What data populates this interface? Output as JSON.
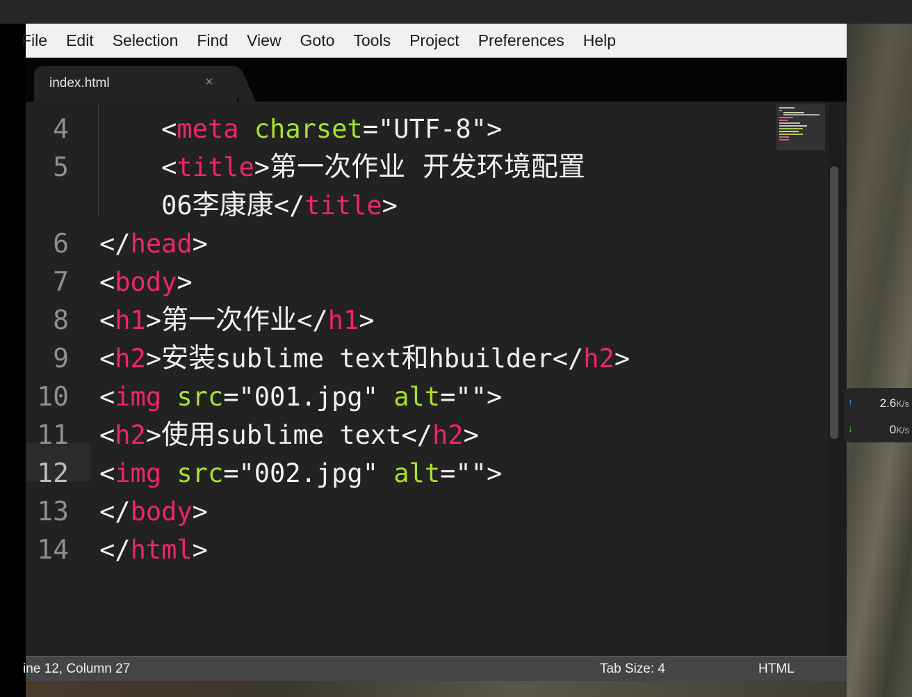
{
  "menubar": {
    "items": [
      "File",
      "Edit",
      "Selection",
      "Find",
      "View",
      "Goto",
      "Tools",
      "Project",
      "Preferences",
      "Help"
    ]
  },
  "tab": {
    "title": "index.html",
    "close_glyph": "×"
  },
  "editor": {
    "current_line": 12,
    "lines": [
      {
        "number": "4",
        "tokens": [
          {
            "t": "    ",
            "c": "p"
          },
          {
            "t": "<",
            "c": "p"
          },
          {
            "t": "meta",
            "c": "tag"
          },
          {
            "t": " ",
            "c": "p"
          },
          {
            "t": "charset",
            "c": "attr"
          },
          {
            "t": "=",
            "c": "p"
          },
          {
            "t": "\"UTF-8\"",
            "c": "p"
          },
          {
            "t": ">",
            "c": "p"
          }
        ]
      },
      {
        "number": "5",
        "tokens": [
          {
            "t": "    ",
            "c": "p"
          },
          {
            "t": "<",
            "c": "p"
          },
          {
            "t": "title",
            "c": "tag"
          },
          {
            "t": ">",
            "c": "p"
          },
          {
            "t": "第一次作业  开发环境配置",
            "c": "cjk"
          }
        ]
      },
      {
        "number": "",
        "tokens": [
          {
            "t": "    ",
            "c": "p"
          },
          {
            "t": "06",
            "c": "p"
          },
          {
            "t": "李康康",
            "c": "cjk"
          },
          {
            "t": "</",
            "c": "p"
          },
          {
            "t": "title",
            "c": "tag"
          },
          {
            "t": ">",
            "c": "p"
          }
        ]
      },
      {
        "number": "6",
        "tokens": [
          {
            "t": "</",
            "c": "p"
          },
          {
            "t": "head",
            "c": "tag"
          },
          {
            "t": ">",
            "c": "p"
          }
        ]
      },
      {
        "number": "7",
        "tokens": [
          {
            "t": "<",
            "c": "p"
          },
          {
            "t": "body",
            "c": "tag"
          },
          {
            "t": ">",
            "c": "p"
          }
        ]
      },
      {
        "number": "8",
        "tokens": [
          {
            "t": "<",
            "c": "p"
          },
          {
            "t": "h1",
            "c": "tag"
          },
          {
            "t": ">",
            "c": "p"
          },
          {
            "t": "第一次作业",
            "c": "cjk"
          },
          {
            "t": "</",
            "c": "p"
          },
          {
            "t": "h1",
            "c": "tag"
          },
          {
            "t": ">",
            "c": "p"
          }
        ]
      },
      {
        "number": "9",
        "tokens": [
          {
            "t": "<",
            "c": "p"
          },
          {
            "t": "h2",
            "c": "tag"
          },
          {
            "t": ">",
            "c": "p"
          },
          {
            "t": "安装",
            "c": "cjk"
          },
          {
            "t": "sublime text",
            "c": "p"
          },
          {
            "t": "和",
            "c": "cjk"
          },
          {
            "t": "hbuilder",
            "c": "p"
          },
          {
            "t": "</",
            "c": "p"
          },
          {
            "t": "h2",
            "c": "tag"
          },
          {
            "t": ">",
            "c": "p"
          }
        ]
      },
      {
        "number": "10",
        "tokens": [
          {
            "t": "<",
            "c": "p"
          },
          {
            "t": "img",
            "c": "tag"
          },
          {
            "t": " ",
            "c": "p"
          },
          {
            "t": "src",
            "c": "attr"
          },
          {
            "t": "=",
            "c": "p"
          },
          {
            "t": "\"001.jpg\"",
            "c": "p"
          },
          {
            "t": " ",
            "c": "p"
          },
          {
            "t": "alt",
            "c": "attr"
          },
          {
            "t": "=",
            "c": "p"
          },
          {
            "t": "\"\"",
            "c": "p"
          },
          {
            "t": ">",
            "c": "p"
          }
        ]
      },
      {
        "number": "11",
        "tokens": [
          {
            "t": "<",
            "c": "p"
          },
          {
            "t": "h2",
            "c": "tag"
          },
          {
            "t": ">",
            "c": "p"
          },
          {
            "t": "使用",
            "c": "cjk"
          },
          {
            "t": "sublime text",
            "c": "p"
          },
          {
            "t": "</",
            "c": "p"
          },
          {
            "t": "h2",
            "c": "tag"
          },
          {
            "t": ">",
            "c": "p"
          }
        ]
      },
      {
        "number": "12",
        "tokens": [
          {
            "t": "<",
            "c": "p"
          },
          {
            "t": "img",
            "c": "tag"
          },
          {
            "t": " ",
            "c": "p"
          },
          {
            "t": "src",
            "c": "attr"
          },
          {
            "t": "=",
            "c": "p"
          },
          {
            "t": "\"002.jpg\"",
            "c": "p"
          },
          {
            "t": " ",
            "c": "p"
          },
          {
            "t": "alt",
            "c": "attr"
          },
          {
            "t": "=",
            "c": "p"
          },
          {
            "t": "\"\"",
            "c": "p"
          },
          {
            "t": ">",
            "c": "p"
          }
        ]
      },
      {
        "number": "13",
        "tokens": [
          {
            "t": "</",
            "c": "p"
          },
          {
            "t": "body",
            "c": "tag"
          },
          {
            "t": ">",
            "c": "p"
          }
        ]
      },
      {
        "number": "14",
        "tokens": [
          {
            "t": "</",
            "c": "p"
          },
          {
            "t": "html",
            "c": "tag"
          },
          {
            "t": ">",
            "c": "p"
          }
        ]
      }
    ]
  },
  "statusbar": {
    "position": "ine 12, Column 27",
    "tab_size": "Tab Size: 4",
    "syntax": "HTML"
  },
  "network_widget": {
    "upload_value": "2.6",
    "upload_unit": "K/s",
    "download_value": "0",
    "download_unit": "K/s"
  },
  "colors": {
    "tag": "#f0246e",
    "attr": "#a6e22e",
    "punct": "#f0f0f0",
    "editor_bg": "#222222"
  }
}
